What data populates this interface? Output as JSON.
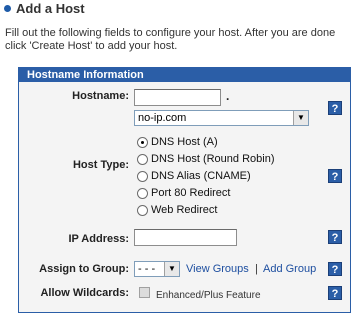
{
  "page": {
    "title": "Add a Host",
    "intro": "Fill out the following fields to configure your host. After you are done click 'Create Host' to add your host."
  },
  "panel": {
    "header": "Hostname Information",
    "hostname": {
      "label": "Hostname:",
      "value": "",
      "separator": ".",
      "domain_selected": "no-ip.com",
      "help": "?"
    },
    "host_type": {
      "label": "Host Type:",
      "options": [
        {
          "label": "DNS Host (A)",
          "checked": true
        },
        {
          "label": "DNS Host (Round Robin)",
          "checked": false
        },
        {
          "label": "DNS Alias (CNAME)",
          "checked": false
        },
        {
          "label": "Port 80 Redirect",
          "checked": false
        },
        {
          "label": "Web Redirect",
          "checked": false
        }
      ],
      "help": "?"
    },
    "ip_address": {
      "label": "IP Address:",
      "value": "",
      "help": "?"
    },
    "group": {
      "label": "Assign to Group:",
      "selected": "- - -",
      "view_groups": "View Groups",
      "separator": "|",
      "add_group": "Add Group",
      "help": "?"
    },
    "wildcards": {
      "label": "Allow Wildcards:",
      "checked": false,
      "feature_note": "Enhanced/Plus Feature",
      "help": "?"
    }
  },
  "colors": {
    "accent": "#2b5ea7",
    "panel_bg": "#f4f4f4",
    "link": "#1e4fa0"
  }
}
